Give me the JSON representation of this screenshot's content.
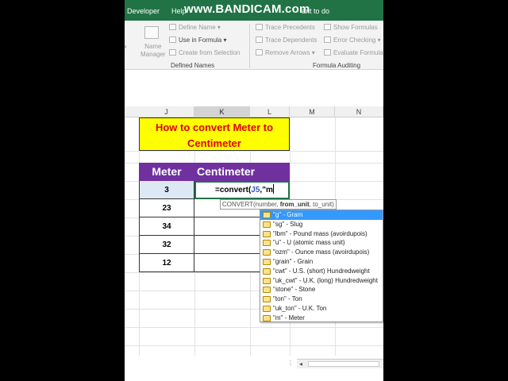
{
  "ribbon": {
    "tabs": [
      "Developer",
      "Help"
    ],
    "watermark": "www.BANDICAM.com",
    "tell_me": "ant to do",
    "defined_names": {
      "name_manager": [
        "Name",
        "Manager"
      ],
      "define_name": "Define Name",
      "use_in_formula": "Use in Formula",
      "create_from_selection": "Create from Selection",
      "group_label": "Defined Names"
    },
    "formula_auditing": {
      "trace_precedents": "Trace Precedents",
      "trace_dependents": "Trace Dependents",
      "remove_arrows": "Remove Arrows",
      "show_formulas": "Show Formulas",
      "error_checking": "Error Checking",
      "evaluate_formula": "Evaluate Formula",
      "group_label": "Formula Auditing"
    }
  },
  "columns": [
    "J",
    "K",
    "L",
    "M",
    "N"
  ],
  "sheet": {
    "title": "How to convert Meter to Centimeter",
    "title_line1": "How to convert Meter to",
    "title_line2": "Centimeter",
    "header_meter": "Meter",
    "header_cm": "Centimeter",
    "meters": [
      "3",
      "23",
      "34",
      "32",
      "12"
    ],
    "active_formula": {
      "prefix": "=convert(",
      "ref": "J5",
      "suffix": ",\"m"
    }
  },
  "tooltip": {
    "fn": "CONVERT(number, ",
    "bold": "from_unit",
    "rest": ", to_unit)"
  },
  "autocomplete": [
    "\"g\" - Gram",
    "\"sg\" - Slug",
    "\"lbm\" - Pound mass (avoirdupois)",
    "\"u\" - U (atomic mass unit)",
    "\"ozm\" - Ounce mass (avoirdupois)",
    "\"grain\" - Grain",
    "\"cwt\" - U.S. (short) Hundredweight",
    "\"uk_cwt\" - U.K. (long) Hundredweight",
    "\"stone\" - Stone",
    "\"ton\" - Ton",
    "\"uk_ton\" - U.K. Ton",
    "\"m\" - Meter"
  ],
  "colors": {
    "excel_green": "#217346",
    "title_bg": "#ffff00",
    "title_text": "#e00000",
    "header_bg": "#7030a0",
    "selection": "#3399ff"
  }
}
